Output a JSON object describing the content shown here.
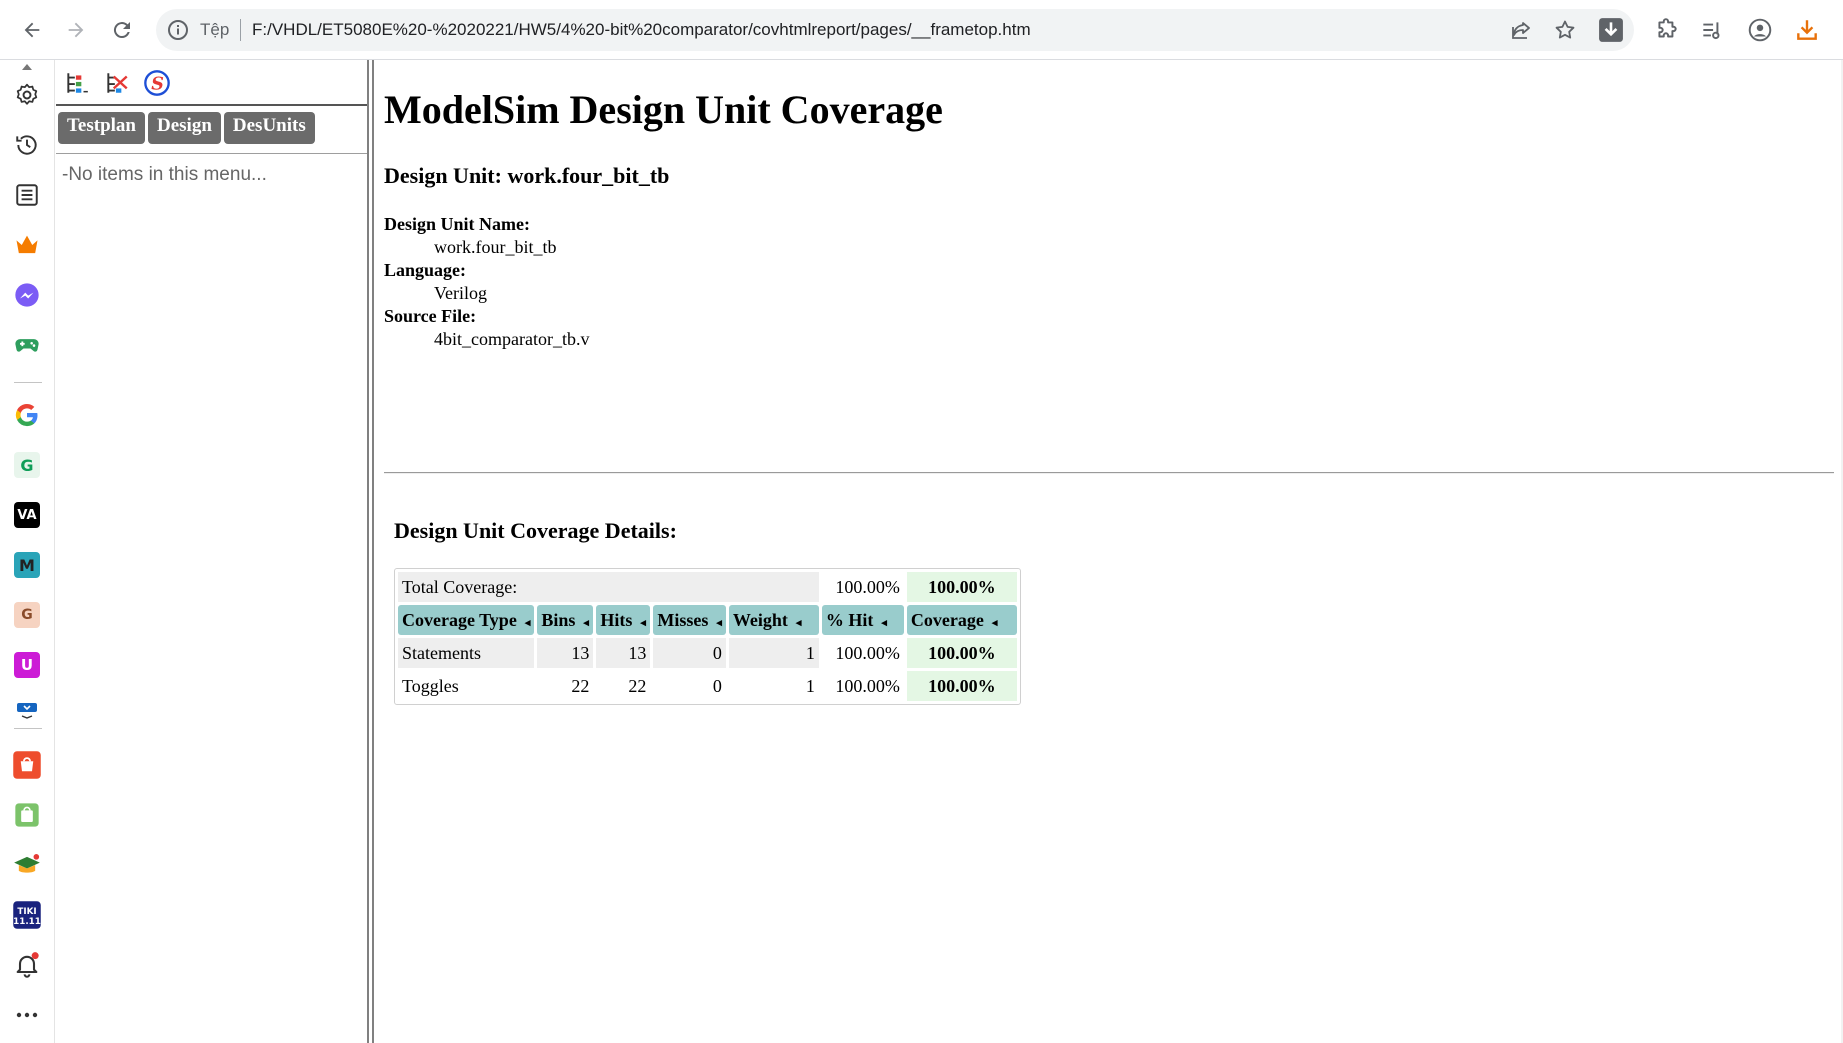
{
  "browser": {
    "site_info_label": "Tệp",
    "url": "F:/VHDL/ET5080E%20-%2020221/HW5/4%20-bit%20comparator/covhtmlreport/pages/__frametop.htm"
  },
  "sidebar": {
    "tiles": [
      {
        "letter": "G",
        "color": "#0f9d58"
      },
      {
        "letter": "VA",
        "color": "#000000"
      },
      {
        "letter": "M",
        "color": "#2aa4b8"
      },
      {
        "letter": "G",
        "color": "#e0a080"
      },
      {
        "letter": "U",
        "color": "#cc1bd6"
      }
    ]
  },
  "left_frame": {
    "tabs": [
      "Testplan",
      "Design",
      "DesUnits"
    ],
    "empty_message": "-No items in this menu..."
  },
  "report": {
    "title": "ModelSim Design Unit Coverage",
    "subtitle": "Design Unit: work.four_bit_tb",
    "fields": {
      "name_label": "Design Unit Name:",
      "name_value": "work.four_bit_tb",
      "language_label": "Language:",
      "language_value": "Verilog",
      "source_label": "Source File:",
      "source_value": "4bit_comparator_tb.v"
    },
    "details_title": "Design Unit Coverage Details:",
    "table": {
      "total_label": "Total Coverage:",
      "total_pct": "100.00%",
      "total_coverage": "100.00%",
      "headers": [
        "Coverage Type",
        "Bins",
        "Hits",
        "Misses",
        "Weight",
        "% Hit",
        "Coverage"
      ],
      "sort_glyph": "◂",
      "rows": [
        {
          "type": "Statements",
          "bins": "13",
          "hits": "13",
          "misses": "0",
          "weight": "1",
          "pct": "100.00%",
          "coverage": "100.00%"
        },
        {
          "type": "Toggles",
          "bins": "22",
          "hits": "22",
          "misses": "0",
          "weight": "1",
          "pct": "100.00%",
          "coverage": "100.00%"
        }
      ]
    }
  },
  "colors": {
    "header_bg": "#99cccc",
    "coverage_bg": "#e4f7e4",
    "tab_bg": "#6b6b6b",
    "download_accent": "#e8710a"
  }
}
